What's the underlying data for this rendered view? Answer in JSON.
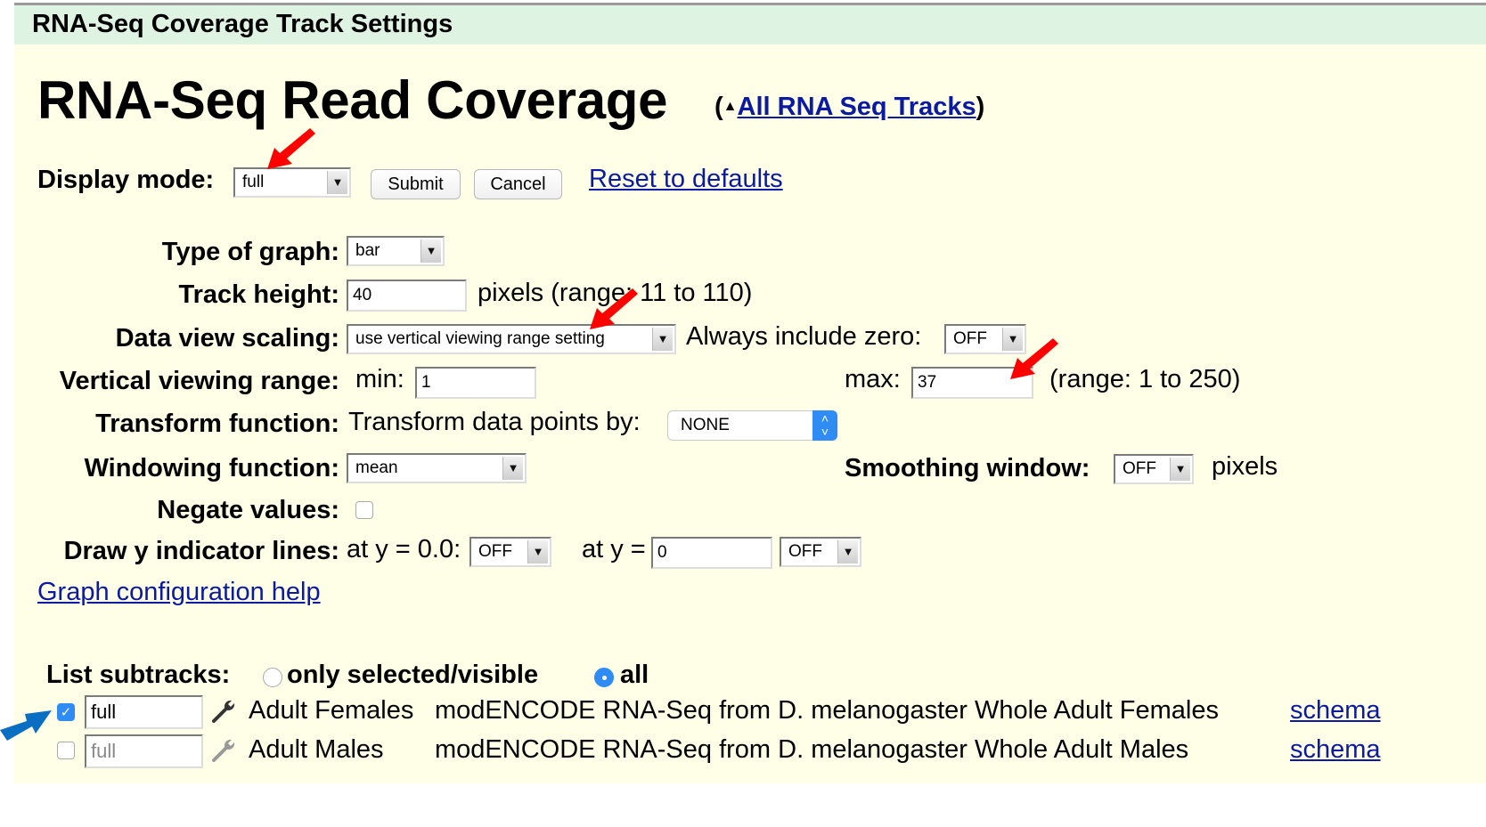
{
  "header": {
    "title": "RNA-Seq Coverage Track Settings"
  },
  "page": {
    "title": "RNA-Seq Read Coverage",
    "parent_link_prefix": "(",
    "parent_link_arrow": "▲",
    "parent_link_label": "All RNA Seq Tracks",
    "parent_link_suffix": ")"
  },
  "display_mode": {
    "label": "Display mode:",
    "value": "full",
    "submit_label": "Submit",
    "cancel_label": "Cancel",
    "reset_label": "Reset to defaults"
  },
  "settings": {
    "type_of_graph": {
      "label": "Type of graph:",
      "value": "bar"
    },
    "track_height": {
      "label": "Track height:",
      "value": "40",
      "suffix": "pixels (range: 11 to 110)"
    },
    "data_view_scaling": {
      "label": "Data view scaling:",
      "value": "use vertical viewing range setting",
      "always_zero_label": "Always include zero:",
      "always_zero_value": "OFF"
    },
    "vertical_range": {
      "label": "Vertical viewing range:",
      "min_label": "min:",
      "min_value": "1",
      "max_label": "max:",
      "max_value": "37",
      "range_note": "(range: 1 to 250)"
    },
    "transform": {
      "label": "Transform function:",
      "prompt": "Transform data points by:",
      "value": "NONE"
    },
    "windowing": {
      "label": "Windowing function:",
      "value": "mean",
      "smoothing_label": "Smoothing window:",
      "smoothing_value": "OFF",
      "smoothing_suffix": "pixels"
    },
    "negate": {
      "label": "Negate values:",
      "checked": false
    },
    "indicator_lines": {
      "label": "Draw y indicator lines:",
      "at_zero_label": "at y = 0.0:",
      "at_zero_value": "OFF",
      "at_y_label": "at y =",
      "at_y_input": "0",
      "at_y_value": "OFF"
    },
    "help_link": "Graph configuration help"
  },
  "subtracks": {
    "label": "List subtracks:",
    "option_selected": "only selected/visible",
    "option_all": "all",
    "selected_option": "all",
    "rows": [
      {
        "checked": true,
        "mode": "full",
        "name": "Adult Females",
        "description": "modENCODE RNA-Seq from D. melanogaster Whole Adult Females",
        "link": "schema"
      },
      {
        "checked": false,
        "mode": "full",
        "name": "Adult Males",
        "description": "modENCODE RNA-Seq from D. melanogaster Whole Adult Males",
        "link": "schema"
      }
    ]
  },
  "annotations": {
    "arrow_red": "#ff0000",
    "arrow_blue": "#0a6fc2"
  },
  "icons": {
    "dropdown": "▼",
    "stepper": "⇕",
    "check": "✓",
    "wrench": "wrench-icon"
  }
}
